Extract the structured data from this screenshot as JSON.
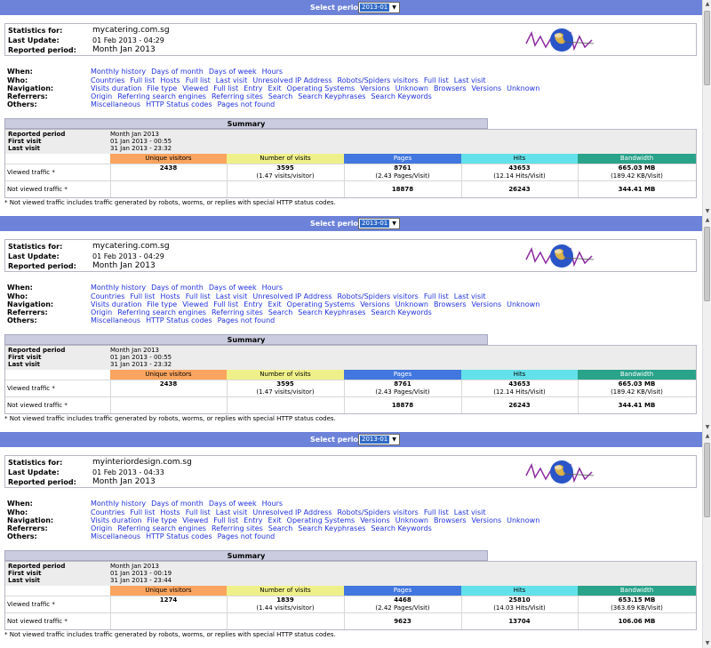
{
  "reports": [
    {
      "period_label": "Select period",
      "period_value": "2013-01",
      "info": {
        "stats_label": "Statistics for:",
        "site": "mycatering.com.sg",
        "update_label": "Last Update:",
        "update": "01 Feb 2013 - 04:29",
        "period_label": "Reported period:",
        "period": "Month Jan 2013"
      },
      "menu": [
        {
          "label": "When:",
          "links": [
            "Monthly history",
            "Days of month",
            "Days of week",
            "Hours"
          ]
        },
        {
          "label": "Who:",
          "links": [
            "Countries",
            "Full list",
            "Hosts",
            "Full list",
            "Last visit",
            "Unresolved IP Address",
            "Robots/Spiders visitors",
            "Full list",
            "Last visit"
          ]
        },
        {
          "label": "Navigation:",
          "links": [
            "Visits duration",
            "File type",
            "Viewed",
            "Full list",
            "Entry",
            "Exit",
            "Operating Systems",
            "Versions",
            "Unknown",
            "Browsers",
            "Versions",
            "Unknown"
          ]
        },
        {
          "label": "Referrers:",
          "links": [
            "Origin",
            "Referring search engines",
            "Referring sites",
            "Search",
            "Search Keyphrases",
            "Search Keywords"
          ]
        },
        {
          "label": "Others:",
          "links": [
            "Miscellaneous",
            "HTTP Status codes",
            "Pages not found"
          ]
        }
      ],
      "summary": {
        "title": "Summary",
        "reported_label": "Reported period",
        "reported": "Month Jan 2013",
        "first_label": "First visit",
        "first": "01 Jan 2013 - 00:55",
        "last_label": "Last visit",
        "last": "31 Jan 2013 - 23:32",
        "headers": [
          "Unique visitors",
          "Number of visits",
          "Pages",
          "Hits",
          "Bandwidth"
        ],
        "viewed_label": "Viewed traffic *",
        "viewed": {
          "unique": "2438",
          "visits": "3595",
          "visits_sub": "(1.47 visits/visitor)",
          "pages": "8761",
          "pages_sub": "(2.43 Pages/Visit)",
          "hits": "43653",
          "hits_sub": "(12.14 Hits/Visit)",
          "bw": "665.03 MB",
          "bw_sub": "(189.42 KB/Visit)"
        },
        "not_viewed_label": "Not viewed traffic *",
        "not_viewed": {
          "pages": "18878",
          "hits": "26243",
          "bw": "344.41 MB"
        }
      },
      "footnote": "* Not viewed traffic includes traffic generated by robots, worms, or replies with special HTTP status codes."
    },
    {
      "period_label": "Select period",
      "period_value": "2013-01",
      "info": {
        "stats_label": "Statistics for:",
        "site": "mycatering.com.sg",
        "update_label": "Last Update:",
        "update": "01 Feb 2013 - 04:29",
        "period_label": "Reported period:",
        "period": "Month Jan 2013"
      },
      "menu": [
        {
          "label": "When:",
          "links": [
            "Monthly history",
            "Days of month",
            "Days of week",
            "Hours"
          ]
        },
        {
          "label": "Who:",
          "links": [
            "Countries",
            "Full list",
            "Hosts",
            "Full list",
            "Last visit",
            "Unresolved IP Address",
            "Robots/Spiders visitors",
            "Full list",
            "Last visit"
          ]
        },
        {
          "label": "Navigation:",
          "links": [
            "Visits duration",
            "File type",
            "Viewed",
            "Full list",
            "Entry",
            "Exit",
            "Operating Systems",
            "Versions",
            "Unknown",
            "Browsers",
            "Versions",
            "Unknown"
          ]
        },
        {
          "label": "Referrers:",
          "links": [
            "Origin",
            "Referring search engines",
            "Referring sites",
            "Search",
            "Search Keyphrases",
            "Search Keywords"
          ]
        },
        {
          "label": "Others:",
          "links": [
            "Miscellaneous",
            "HTTP Status codes",
            "Pages not found"
          ]
        }
      ],
      "summary": {
        "title": "Summary",
        "reported_label": "Reported period",
        "reported": "Month Jan 2013",
        "first_label": "First visit",
        "first": "01 Jan 2013 - 00:55",
        "last_label": "Last visit",
        "last": "31 Jan 2013 - 23:32",
        "headers": [
          "Unique visitors",
          "Number of visits",
          "Pages",
          "Hits",
          "Bandwidth"
        ],
        "viewed_label": "Viewed traffic *",
        "viewed": {
          "unique": "2438",
          "visits": "3595",
          "visits_sub": "(1.47 visits/visitor)",
          "pages": "8761",
          "pages_sub": "(2.43 Pages/Visit)",
          "hits": "43653",
          "hits_sub": "(12.14 Hits/Visit)",
          "bw": "665.03 MB",
          "bw_sub": "(189.42 KB/Visit)"
        },
        "not_viewed_label": "Not viewed traffic *",
        "not_viewed": {
          "pages": "18878",
          "hits": "26243",
          "bw": "344.41 MB"
        }
      },
      "footnote": "* Not viewed traffic includes traffic generated by robots, worms, or replies with special HTTP status codes."
    },
    {
      "period_label": "Select period",
      "period_value": "2013-01",
      "info": {
        "stats_label": "Statistics for:",
        "site": "myinteriordesign.com.sg",
        "update_label": "Last Update:",
        "update": "01 Feb 2013 - 04:33",
        "period_label": "Reported period:",
        "period": "Month Jan 2013"
      },
      "menu": [
        {
          "label": "When:",
          "links": [
            "Monthly history",
            "Days of month",
            "Days of week",
            "Hours"
          ]
        },
        {
          "label": "Who:",
          "links": [
            "Countries",
            "Full list",
            "Hosts",
            "Full list",
            "Last visit",
            "Unresolved IP Address",
            "Robots/Spiders visitors",
            "Full list",
            "Last visit"
          ]
        },
        {
          "label": "Navigation:",
          "links": [
            "Visits duration",
            "File type",
            "Viewed",
            "Full list",
            "Entry",
            "Exit",
            "Operating Systems",
            "Versions",
            "Unknown",
            "Browsers",
            "Versions",
            "Unknown"
          ]
        },
        {
          "label": "Referrers:",
          "links": [
            "Origin",
            "Referring search engines",
            "Referring sites",
            "Search",
            "Search Keyphrases",
            "Search Keywords"
          ]
        },
        {
          "label": "Others:",
          "links": [
            "Miscellaneous",
            "HTTP Status codes",
            "Pages not found"
          ]
        }
      ],
      "summary": {
        "title": "Summary",
        "reported_label": "Reported period",
        "reported": "Month Jan 2013",
        "first_label": "First visit",
        "first": "01 Jan 2013 - 00:19",
        "last_label": "Last visit",
        "last": "31 Jan 2013 - 23:44",
        "headers": [
          "Unique visitors",
          "Number of visits",
          "Pages",
          "Hits",
          "Bandwidth"
        ],
        "viewed_label": "Viewed traffic *",
        "viewed": {
          "unique": "1274",
          "visits": "1839",
          "visits_sub": "(1.44 visits/visitor)",
          "pages": "4468",
          "pages_sub": "(2.42 Pages/Visit)",
          "hits": "25810",
          "hits_sub": "(14.03 Hits/Visit)",
          "bw": "653.15 MB",
          "bw_sub": "(363.69 KB/Visit)"
        },
        "not_viewed_label": "Not viewed traffic *",
        "not_viewed": {
          "pages": "9623",
          "hits": "13704",
          "bw": "106.06 MB"
        }
      },
      "footnote": "* Not viewed traffic includes traffic generated by robots, worms, or replies with special HTTP status codes."
    }
  ]
}
